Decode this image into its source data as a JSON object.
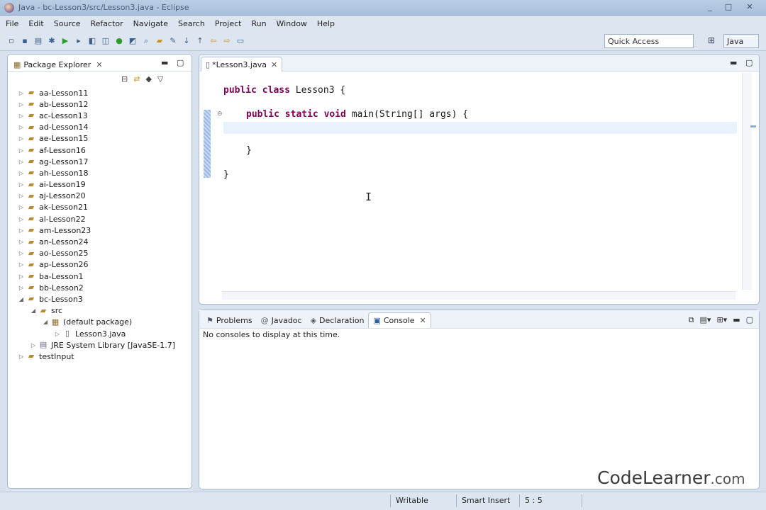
{
  "window": {
    "title": "Java - bc-Lesson3/src/Lesson3.java - Eclipse",
    "min": "_",
    "max": "□",
    "close": "✕"
  },
  "menu": [
    "File",
    "Edit",
    "Source",
    "Refactor",
    "Navigate",
    "Search",
    "Project",
    "Run",
    "Window",
    "Help"
  ],
  "toolbar": {
    "quick_access": "Quick Access",
    "perspective": "Java"
  },
  "package_explorer": {
    "title": "Package Explorer",
    "items": [
      {
        "label": "aa-Lesson11",
        "level": 0,
        "twisty": "▷"
      },
      {
        "label": "ab-Lesson12",
        "level": 0,
        "twisty": "▷"
      },
      {
        "label": "ac-Lesson13",
        "level": 0,
        "twisty": "▷"
      },
      {
        "label": "ad-Lesson14",
        "level": 0,
        "twisty": "▷"
      },
      {
        "label": "ae-Lesson15",
        "level": 0,
        "twisty": "▷"
      },
      {
        "label": "af-Lesson16",
        "level": 0,
        "twisty": "▷"
      },
      {
        "label": "ag-Lesson17",
        "level": 0,
        "twisty": "▷"
      },
      {
        "label": "ah-Lesson18",
        "level": 0,
        "twisty": "▷"
      },
      {
        "label": "ai-Lesson19",
        "level": 0,
        "twisty": "▷"
      },
      {
        "label": "aj-Lesson20",
        "level": 0,
        "twisty": "▷"
      },
      {
        "label": "ak-Lesson21",
        "level": 0,
        "twisty": "▷"
      },
      {
        "label": "al-Lesson22",
        "level": 0,
        "twisty": "▷"
      },
      {
        "label": "am-Lesson23",
        "level": 0,
        "twisty": "▷"
      },
      {
        "label": "an-Lesson24",
        "level": 0,
        "twisty": "▷"
      },
      {
        "label": "ao-Lesson25",
        "level": 0,
        "twisty": "▷"
      },
      {
        "label": "ap-Lesson26",
        "level": 0,
        "twisty": "▷"
      },
      {
        "label": "ba-Lesson1",
        "level": 0,
        "twisty": "▷"
      },
      {
        "label": "bb-Lesson2",
        "level": 0,
        "twisty": "▷"
      },
      {
        "label": "bc-Lesson3",
        "level": 0,
        "twisty": "◢"
      },
      {
        "label": "src",
        "level": 1,
        "twisty": "◢"
      },
      {
        "label": "(default package)",
        "level": 2,
        "twisty": "◢"
      },
      {
        "label": "Lesson3.java",
        "level": 3,
        "twisty": "▷"
      },
      {
        "label": "JRE System Library [JavaSE-1.7]",
        "level": 1,
        "twisty": "▷"
      },
      {
        "label": "testInput",
        "level": 0,
        "twisty": "▷"
      }
    ]
  },
  "editor": {
    "tab_label": "*Lesson3.java",
    "code": {
      "l1_kw": "public class",
      "l1_rest": " Lesson3 {",
      "l2_kw": "public static void",
      "l2_rest": " main(String[] args) {",
      "l4": "}",
      "l5": "}"
    },
    "cursor_glyph": "I"
  },
  "bottom_panel": {
    "tabs": [
      {
        "label": "Problems",
        "active": false
      },
      {
        "label": "Javadoc",
        "active": false
      },
      {
        "label": "Declaration",
        "active": false
      },
      {
        "label": "Console",
        "active": true
      }
    ],
    "console_message": "No consoles to display at this time."
  },
  "status_bar": {
    "writable": "Writable",
    "insert_mode": "Smart Insert",
    "position": "5 : 5"
  },
  "watermark": {
    "brand": "CodeLearner",
    "domain": ".com"
  }
}
